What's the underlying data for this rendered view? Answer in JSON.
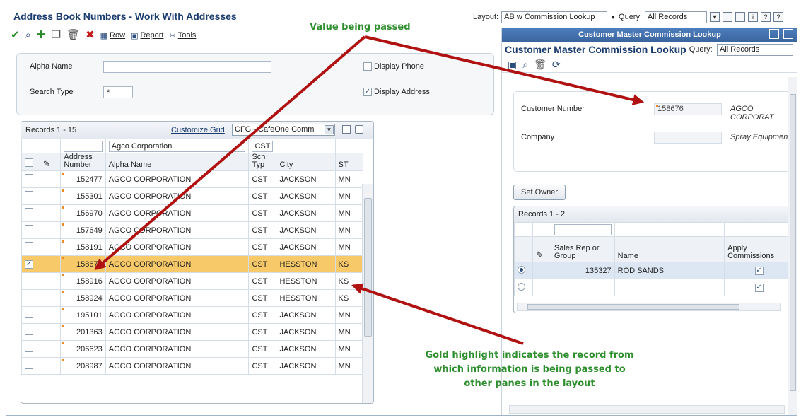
{
  "left": {
    "title": "Address Book Numbers - Work With Addresses",
    "toolbar": {
      "icons": [
        "check-icon",
        "find-icon",
        "add-icon",
        "copy-icon",
        "delete-icon",
        "close-icon"
      ],
      "row_label": "Row",
      "report_label": "Report",
      "tools_label": "Tools"
    },
    "search": {
      "alpha_name_label": "Alpha Name",
      "alpha_name_value": "",
      "search_type_label": "Search Type",
      "search_type_value": "*",
      "display_phone_label": "Display Phone",
      "display_phone_checked": false,
      "display_address_label": "Display Address",
      "display_address_checked": true
    },
    "grid": {
      "records_label": "Records 1 - 15",
      "customize_grid_label": "Customize Grid",
      "format_select": "CFG - CafeOne Comm",
      "qbe": {
        "alpha_name": "Agco Corporation",
        "sch_typ": "CST"
      },
      "columns": [
        "Address Number",
        "Alpha Name",
        "Sch Typ",
        "City",
        "ST"
      ],
      "rows": [
        {
          "address_number": "152477",
          "alpha_name": "AGCO CORPORATION",
          "sch_typ": "CST",
          "city": "JACKSON",
          "st": "MN",
          "checked": false,
          "highlight": false
        },
        {
          "address_number": "155301",
          "alpha_name": "AGCO CORPORATION",
          "sch_typ": "CST",
          "city": "JACKSON",
          "st": "MN",
          "checked": false,
          "highlight": false
        },
        {
          "address_number": "156970",
          "alpha_name": "AGCO CORPORATION",
          "sch_typ": "CST",
          "city": "JACKSON",
          "st": "MN",
          "checked": false,
          "highlight": false
        },
        {
          "address_number": "157649",
          "alpha_name": "AGCO CORPORATION",
          "sch_typ": "CST",
          "city": "JACKSON",
          "st": "MN",
          "checked": false,
          "highlight": false
        },
        {
          "address_number": "158191",
          "alpha_name": "AGCO CORPORATION",
          "sch_typ": "CST",
          "city": "JACKSON",
          "st": "MN",
          "checked": false,
          "highlight": false
        },
        {
          "address_number": "158676",
          "alpha_name": "AGCO CORPORATION",
          "sch_typ": "CST",
          "city": "HESSTON",
          "st": "KS",
          "checked": true,
          "highlight": true
        },
        {
          "address_number": "158916",
          "alpha_name": "AGCO CORPORATION",
          "sch_typ": "CST",
          "city": "HESSTON",
          "st": "KS",
          "checked": false,
          "highlight": false
        },
        {
          "address_number": "158924",
          "alpha_name": "AGCO CORPORATION",
          "sch_typ": "CST",
          "city": "HESSTON",
          "st": "KS",
          "checked": false,
          "highlight": false
        },
        {
          "address_number": "195101",
          "alpha_name": "AGCO CORPORATION",
          "sch_typ": "CST",
          "city": "JACKSON",
          "st": "MN",
          "checked": false,
          "highlight": false
        },
        {
          "address_number": "201363",
          "alpha_name": "AGCO CORPORATION",
          "sch_typ": "CST",
          "city": "JACKSON",
          "st": "MN",
          "checked": false,
          "highlight": false
        },
        {
          "address_number": "206623",
          "alpha_name": "AGCO CORPORATION",
          "sch_typ": "CST",
          "city": "JACKSON",
          "st": "MN",
          "checked": false,
          "highlight": false
        },
        {
          "address_number": "208987",
          "alpha_name": "AGCO CORPORATION",
          "sch_typ": "CST",
          "city": "JACKSON",
          "st": "MN",
          "checked": false,
          "highlight": false
        }
      ]
    }
  },
  "layout_bar": {
    "layout_label": "Layout:",
    "layout_value": "AB w Commission Lookup",
    "query_label": "Query:",
    "query_value": "All Records"
  },
  "right": {
    "header": "Customer Master Commission Lookup",
    "title": "Customer Master Commission Lookup",
    "query_label": "Query:",
    "query_value": "All Records",
    "customer_number_label": "Customer Number",
    "customer_number_value": "158676",
    "customer_name": "AGCO CORPORAT",
    "company_label": "Company",
    "company_value": "",
    "company_desc": "Spray Equipment",
    "set_owner_label": "Set Owner",
    "grid": {
      "records_label": "Records 1 - 2",
      "columns": [
        "Sales Rep or Group",
        "Name",
        "Apply Commissions"
      ],
      "rows": [
        {
          "sales_rep": "135327",
          "name": "ROD SANDS",
          "apply": true,
          "selected": true
        },
        {
          "sales_rep": "",
          "name": "",
          "apply": true,
          "selected": false
        }
      ]
    }
  },
  "annotations": {
    "value_passed": "Value being passed",
    "gold_highlight": "Gold highlight indicates the record from which information is being passed to other panes in the layout"
  },
  "colors": {
    "highlight": "#f7c969",
    "arrow": "#b01212",
    "annotation": "#2f8f2f",
    "title": "#1a3c6e"
  }
}
